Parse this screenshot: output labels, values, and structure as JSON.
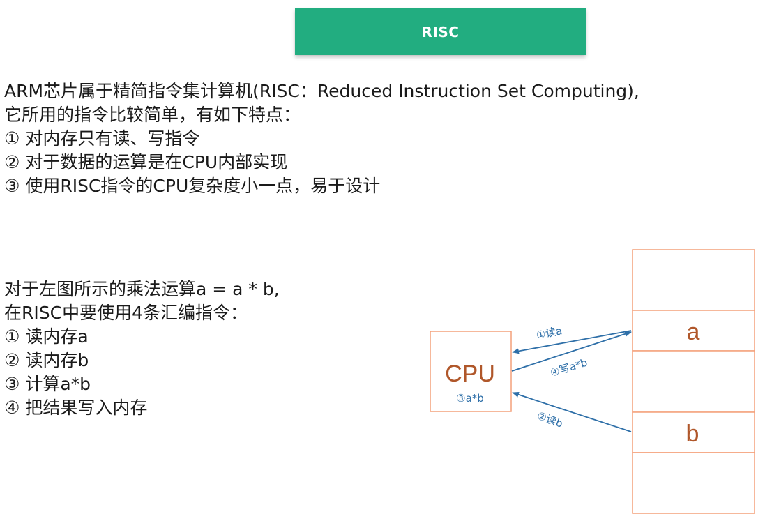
{
  "banner": {
    "title": "RISC"
  },
  "intro": {
    "lines": [
      "ARM芯片属于精简指令集计算机(RISC：Reduced Instruction Set Computing),",
      "它所用的指令比较简单，有如下特点：",
      "① 对内存只有读、写指令",
      "② 对于数据的运算是在CPU内部实现",
      "③ 使用RISC指令的CPU复杂度小一点，易于设计"
    ]
  },
  "example": {
    "lines": [
      "对于左图所示的乘法运算a = a * b,",
      "在RISC中要使用4条汇编指令：",
      "① 读内存a",
      "② 读内存b",
      "③ 计算a*b",
      "④ 把结果写入内存"
    ]
  },
  "diagram": {
    "cpu_label": "CPU",
    "cpu_op": "③a*b",
    "memory_cells": [
      "",
      "a",
      "",
      "b",
      ""
    ],
    "arrows": {
      "read_a": "①读a",
      "write_ab": "④写a*b",
      "read_b": "②读b"
    },
    "colors": {
      "box_border": "#f4a07a",
      "label_text": "#b0572a",
      "arrow": "#2e6fa8",
      "banner": "#22ad80"
    }
  }
}
